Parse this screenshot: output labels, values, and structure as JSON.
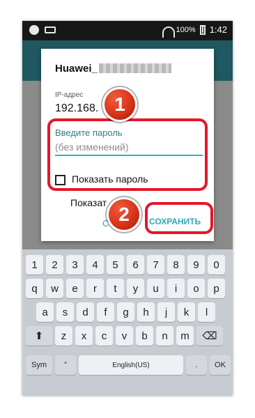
{
  "status_bar": {
    "battery_percent": "100%",
    "time": "1:42"
  },
  "dialog": {
    "title_prefix": "Huawei_",
    "ip_label": "IP-адрес",
    "ip_value": "192.168.",
    "password_label": "Введите пароль",
    "password_placeholder": "(без изменений)",
    "show_password_label": "Показать пароль",
    "extra_label": "Показат",
    "cancel_button_label": "С",
    "save_button_label": "СОХРАНИТЬ"
  },
  "annotations": [
    {
      "label": "1"
    },
    {
      "label": "2"
    }
  ],
  "keyboard": {
    "number_row": [
      "1",
      "2",
      "3",
      "4",
      "5",
      "6",
      "7",
      "8",
      "9",
      "0"
    ],
    "row1": [
      "q",
      "w",
      "e",
      "r",
      "t",
      "y",
      "u",
      "i",
      "o",
      "p"
    ],
    "row2": [
      "a",
      "s",
      "d",
      "f",
      "g",
      "h",
      "j",
      "k",
      "l"
    ],
    "row3": [
      "z",
      "x",
      "c",
      "v",
      "b",
      "n",
      "m"
    ],
    "sym_label": "Sym",
    "language_label": "English(US)",
    "ok_label": "OK"
  },
  "colors": {
    "accent": "#2fa8b7",
    "highlight": "#e51628"
  }
}
